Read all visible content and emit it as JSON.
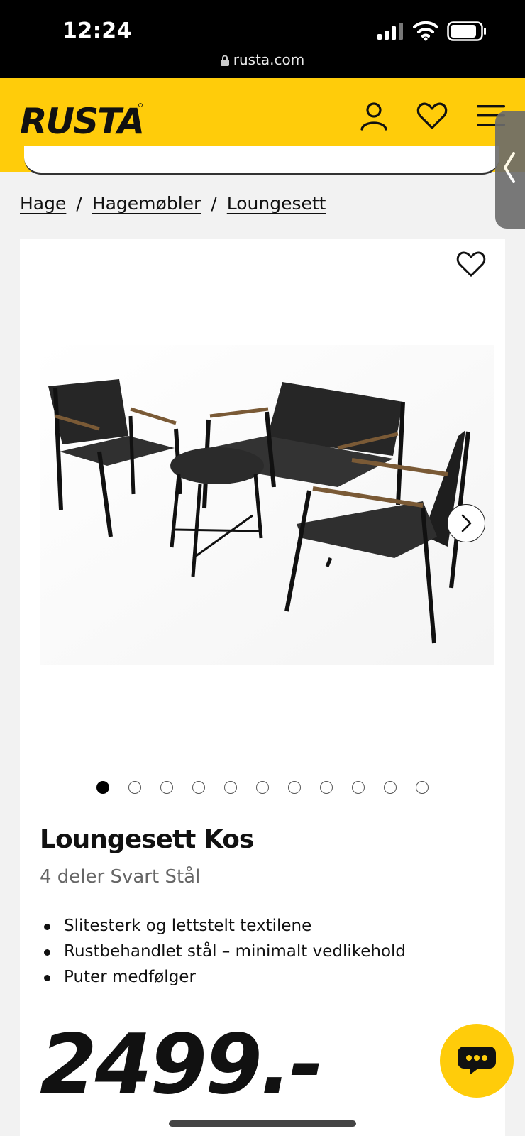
{
  "status_bar": {
    "time": "12:24",
    "url": "rusta.com"
  },
  "header": {
    "logo_text": "RUSTA",
    "brand_color": "#ffcc0a",
    "icons": [
      "user-icon",
      "heart-icon",
      "menu-icon"
    ]
  },
  "breadcrumb": {
    "items": [
      "Hage",
      "Hagemøbler",
      "Loungesett"
    ],
    "separator": "/"
  },
  "gallery": {
    "image_count": 11,
    "active_index": 0
  },
  "product": {
    "title": "Loungesett Kos",
    "subtitle": "4 deler Svart Stål",
    "features": [
      "Slitesterk og lettstelt textilene",
      "Rustbehandlet stål – minimalt vedlikehold",
      "Puter medfølger"
    ],
    "price": "2499.-"
  }
}
